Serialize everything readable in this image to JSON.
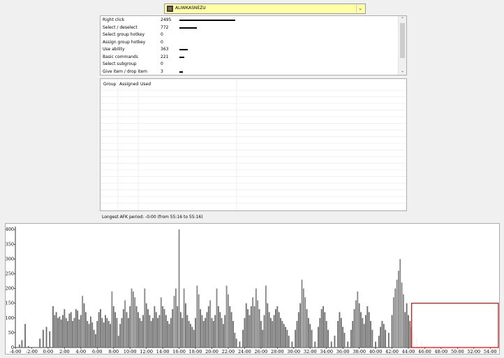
{
  "player": {
    "name": "ALIWKASNEZU",
    "icon": "player-race-icon"
  },
  "stats": [
    {
      "name": "Right click",
      "count": "2495",
      "value": 2495
    },
    {
      "name": "Select / deselect",
      "count": "772",
      "value": 772
    },
    {
      "name": "Select group hotkey",
      "count": "0",
      "value": 0
    },
    {
      "name": "Assign group hotkey",
      "count": "0",
      "value": 0
    },
    {
      "name": "Use ability",
      "count": "363",
      "value": 363
    },
    {
      "name": "Basic commands",
      "count": "221",
      "value": 221
    },
    {
      "name": "Select subgroup",
      "count": "0",
      "value": 0
    },
    {
      "name": "Give item / drop item",
      "count": "3",
      "value": 3
    }
  ],
  "hotkey_table": {
    "columns": [
      "Group",
      "Assigned",
      "Used"
    ]
  },
  "afk": {
    "text": "Longest AFK period: -0:00 (from 55:16 to 55:16)"
  },
  "chart_data": {
    "type": "bar",
    "title": "",
    "xlabel": "",
    "ylabel": "",
    "ylim": [
      0,
      410
    ],
    "xlim_minutes": [
      -4,
      55
    ],
    "y_ticks": [
      0,
      50,
      100,
      150,
      200,
      250,
      300,
      350,
      400
    ],
    "x_tick_labels": [
      "-4:00",
      "-2:00",
      "0:00",
      "2:00",
      "4:00",
      "6:00",
      "8:00",
      "10:00",
      "12:00",
      "14:00",
      "16:00",
      "18:00",
      "20:00",
      "22:00",
      "24:00",
      "26:00",
      "28:00",
      "30:00",
      "32:00",
      "34:00",
      "36:00",
      "38:00",
      "40:00",
      "42:00",
      "44:00",
      "46:00",
      "48:00",
      "50:00",
      "52:00",
      "54:00"
    ],
    "series": [
      {
        "values_by_minute": [
          [
            -3.5,
            10
          ],
          [
            -3.2,
            25
          ],
          [
            -2.8,
            80
          ],
          [
            -2.4,
            5
          ],
          [
            -1.0,
            30
          ],
          [
            -0.6,
            60
          ],
          [
            -0.2,
            70
          ],
          [
            0.2,
            55
          ],
          [
            0.6,
            140
          ],
          [
            0.8,
            110
          ],
          [
            1.0,
            120
          ],
          [
            1.2,
            100
          ],
          [
            1.4,
            105
          ],
          [
            1.6,
            95
          ],
          [
            1.8,
            110
          ],
          [
            2.0,
            130
          ],
          [
            2.2,
            100
          ],
          [
            2.4,
            90
          ],
          [
            2.6,
            115
          ],
          [
            2.8,
            120
          ],
          [
            3.0,
            90
          ],
          [
            3.2,
            100
          ],
          [
            3.4,
            130
          ],
          [
            3.6,
            125
          ],
          [
            3.8,
            95
          ],
          [
            4.0,
            110
          ],
          [
            4.2,
            175
          ],
          [
            4.4,
            150
          ],
          [
            4.6,
            120
          ],
          [
            4.8,
            90
          ],
          [
            5.0,
            80
          ],
          [
            5.2,
            105
          ],
          [
            5.4,
            85
          ],
          [
            5.6,
            60
          ],
          [
            5.8,
            45
          ],
          [
            6.0,
            90
          ],
          [
            6.2,
            120
          ],
          [
            6.4,
            130
          ],
          [
            6.6,
            100
          ],
          [
            6.8,
            85
          ],
          [
            7.0,
            110
          ],
          [
            7.2,
            100
          ],
          [
            7.4,
            90
          ],
          [
            7.6,
            80
          ],
          [
            7.8,
            190
          ],
          [
            8.0,
            140
          ],
          [
            8.2,
            120
          ],
          [
            8.4,
            100
          ],
          [
            8.6,
            40
          ],
          [
            8.8,
            80
          ],
          [
            9.0,
            100
          ],
          [
            9.2,
            130
          ],
          [
            9.4,
            160
          ],
          [
            9.6,
            120
          ],
          [
            9.8,
            100
          ],
          [
            10.0,
            140
          ],
          [
            10.2,
            200
          ],
          [
            10.4,
            190
          ],
          [
            10.6,
            170
          ],
          [
            10.8,
            140
          ],
          [
            11.0,
            120
          ],
          [
            11.2,
            100
          ],
          [
            11.4,
            90
          ],
          [
            11.6,
            110
          ],
          [
            11.8,
            200
          ],
          [
            12.0,
            150
          ],
          [
            12.2,
            130
          ],
          [
            12.4,
            110
          ],
          [
            12.6,
            90
          ],
          [
            12.8,
            100
          ],
          [
            13.0,
            140
          ],
          [
            13.2,
            120
          ],
          [
            13.4,
            100
          ],
          [
            13.6,
            110
          ],
          [
            13.8,
            170
          ],
          [
            14.0,
            140
          ],
          [
            14.2,
            130
          ],
          [
            14.4,
            110
          ],
          [
            14.6,
            90
          ],
          [
            14.8,
            80
          ],
          [
            15.0,
            100
          ],
          [
            15.2,
            130
          ],
          [
            15.4,
            175
          ],
          [
            15.6,
            200
          ],
          [
            15.8,
            140
          ],
          [
            16.0,
            400
          ],
          [
            16.2,
            120
          ],
          [
            16.4,
            100
          ],
          [
            16.6,
            200
          ],
          [
            16.8,
            150
          ],
          [
            17.0,
            110
          ],
          [
            17.2,
            90
          ],
          [
            17.4,
            80
          ],
          [
            17.6,
            70
          ],
          [
            17.8,
            60
          ],
          [
            18.0,
            100
          ],
          [
            18.2,
            210
          ],
          [
            18.4,
            180
          ],
          [
            18.6,
            130
          ],
          [
            18.8,
            110
          ],
          [
            19.0,
            90
          ],
          [
            19.2,
            100
          ],
          [
            19.4,
            120
          ],
          [
            19.6,
            140
          ],
          [
            19.8,
            160
          ],
          [
            20.0,
            100
          ],
          [
            20.2,
            90
          ],
          [
            20.4,
            110
          ],
          [
            20.6,
            200
          ],
          [
            20.8,
            140
          ],
          [
            21.0,
            120
          ],
          [
            21.2,
            100
          ],
          [
            21.4,
            80
          ],
          [
            21.6,
            110
          ],
          [
            21.8,
            210
          ],
          [
            22.0,
            180
          ],
          [
            22.2,
            140
          ],
          [
            22.4,
            120
          ],
          [
            22.6,
            90
          ],
          [
            22.8,
            50
          ],
          [
            23.0,
            30
          ],
          [
            23.4,
            20
          ],
          [
            23.8,
            60
          ],
          [
            24.0,
            100
          ],
          [
            24.2,
            150
          ],
          [
            24.4,
            130
          ],
          [
            24.6,
            110
          ],
          [
            24.8,
            140
          ],
          [
            25.0,
            170
          ],
          [
            25.2,
            140
          ],
          [
            25.4,
            200
          ],
          [
            25.6,
            160
          ],
          [
            25.8,
            130
          ],
          [
            26.0,
            90
          ],
          [
            26.2,
            60
          ],
          [
            26.4,
            110
          ],
          [
            26.6,
            210
          ],
          [
            26.8,
            150
          ],
          [
            27.0,
            120
          ],
          [
            27.2,
            100
          ],
          [
            27.4,
            90
          ],
          [
            27.6,
            110
          ],
          [
            27.8,
            130
          ],
          [
            28.0,
            140
          ],
          [
            28.2,
            120
          ],
          [
            28.4,
            100
          ],
          [
            28.6,
            90
          ],
          [
            28.8,
            80
          ],
          [
            29.0,
            70
          ],
          [
            29.2,
            60
          ],
          [
            29.4,
            40
          ],
          [
            29.8,
            20
          ],
          [
            30.2,
            60
          ],
          [
            30.4,
            90
          ],
          [
            30.6,
            120
          ],
          [
            30.8,
            150
          ],
          [
            31.0,
            230
          ],
          [
            31.2,
            200
          ],
          [
            31.4,
            170
          ],
          [
            31.6,
            130
          ],
          [
            31.8,
            100
          ],
          [
            32.0,
            80
          ],
          [
            32.2,
            60
          ],
          [
            32.6,
            20
          ],
          [
            33.0,
            70
          ],
          [
            33.2,
            100
          ],
          [
            33.4,
            130
          ],
          [
            33.6,
            140
          ],
          [
            33.8,
            120
          ],
          [
            34.0,
            90
          ],
          [
            34.2,
            60
          ],
          [
            34.6,
            20
          ],
          [
            35.0,
            40
          ],
          [
            35.4,
            90
          ],
          [
            35.6,
            120
          ],
          [
            35.8,
            100
          ],
          [
            36.0,
            70
          ],
          [
            36.2,
            50
          ],
          [
            36.6,
            20
          ],
          [
            37.0,
            60
          ],
          [
            37.2,
            90
          ],
          [
            37.4,
            130
          ],
          [
            37.6,
            160
          ],
          [
            37.8,
            190
          ],
          [
            38.0,
            150
          ],
          [
            38.2,
            120
          ],
          [
            38.4,
            100
          ],
          [
            38.6,
            80
          ],
          [
            38.8,
            110
          ],
          [
            39.0,
            140
          ],
          [
            39.2,
            120
          ],
          [
            39.4,
            90
          ],
          [
            39.6,
            60
          ],
          [
            40.0,
            20
          ],
          [
            40.4,
            40
          ],
          [
            40.6,
            70
          ],
          [
            40.8,
            90
          ],
          [
            41.0,
            80
          ],
          [
            41.2,
            60
          ],
          [
            41.6,
            50
          ],
          [
            42.0,
            110
          ],
          [
            42.2,
            170
          ],
          [
            42.4,
            200
          ],
          [
            42.6,
            230
          ],
          [
            42.8,
            260
          ],
          [
            43.0,
            300
          ],
          [
            43.2,
            220
          ],
          [
            43.4,
            180
          ],
          [
            43.6,
            120
          ],
          [
            43.8,
            150
          ],
          [
            44.0,
            110
          ],
          [
            44.2,
            90
          ],
          [
            44.4,
            70
          ],
          [
            44.6,
            50
          ],
          [
            45.0,
            30
          ],
          [
            45.6,
            20
          ],
          [
            46.2,
            5
          ],
          [
            47.0,
            5
          ]
        ]
      }
    ]
  },
  "selection_box": {
    "color": "#e00000",
    "from_minute": 44.4,
    "to_minute": 55
  }
}
